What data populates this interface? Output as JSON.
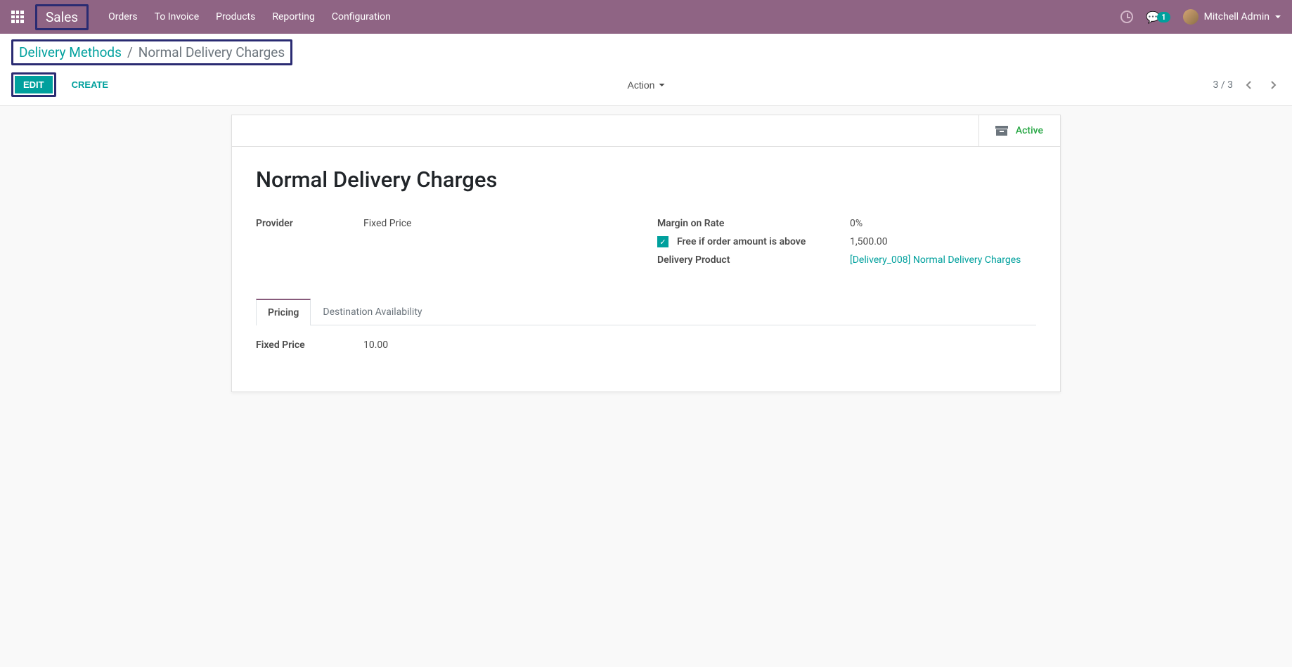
{
  "navbar": {
    "brand": "Sales",
    "menu": [
      "Orders",
      "To Invoice",
      "Products",
      "Reporting",
      "Configuration"
    ],
    "msg_count": "1",
    "username": "Mitchell Admin"
  },
  "breadcrumb": {
    "parent": "Delivery Methods",
    "current": "Normal Delivery Charges"
  },
  "buttons": {
    "edit": "EDIT",
    "create": "CREATE",
    "action": "Action"
  },
  "pager": {
    "text": "3 / 3"
  },
  "sheet": {
    "active_label": "Active",
    "title": "Normal Delivery Charges",
    "left": {
      "provider_label": "Provider",
      "provider_value": "Fixed Price"
    },
    "right": {
      "margin_label": "Margin on Rate",
      "margin_value": "0%",
      "free_label": "Free if order amount is above",
      "free_value": "1,500.00",
      "product_label": "Delivery Product",
      "product_value": "[Delivery_008] Normal Delivery Charges"
    },
    "tabs": {
      "pricing": "Pricing",
      "destination": "Destination Availability"
    },
    "pricing": {
      "fixed_label": "Fixed Price",
      "fixed_value": "10.00"
    }
  }
}
